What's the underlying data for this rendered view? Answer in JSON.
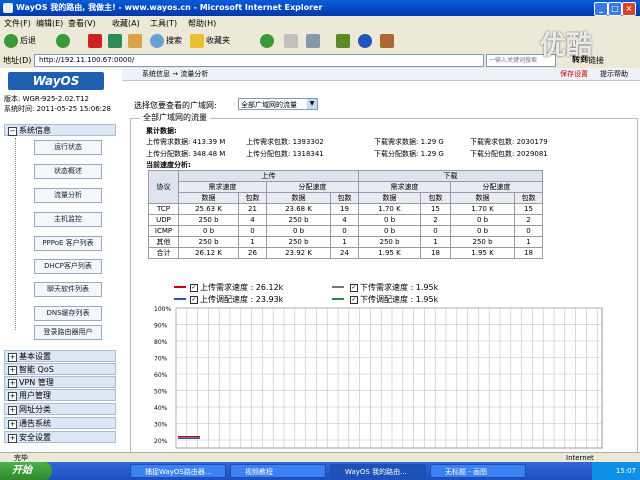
{
  "window": {
    "title": "WayOS 我的路由, 我做主! - www.wayos.cn - Microsoft Internet Explorer"
  },
  "menu": [
    "文件(F)",
    "编辑(E)",
    "查看(V)",
    "收藏(A)",
    "工具(T)",
    "帮助(H)"
  ],
  "toolbar": {
    "back": "后退",
    "search": "搜索",
    "favorites": "收藏夹"
  },
  "address": {
    "label": "地址(D)",
    "value": "http://192.11.100.67:0000/",
    "search_placeholder": "一输入关键词搜索",
    "go": "转到",
    "links": "链接"
  },
  "watermark": "优酷",
  "sidebar": {
    "logo": "WayOS",
    "version": "版本: WGR-925-2.02.T12",
    "sys_time": "系统时间: 2011-05-25 15:06:28",
    "top_section": "系统信息",
    "sub_items": [
      "运行状态",
      "状态概述",
      "流量分析",
      "主机监控",
      "PPPoE 客户列表",
      "DHCP客户列表",
      "聊天软件列表",
      "DNS缓存列表",
      "登录路由器用户"
    ],
    "sections": [
      "基本设置",
      "智能 QoS",
      "VPN 管理",
      "用户管理",
      "网址分类",
      "通告系统",
      "安全设置"
    ]
  },
  "main": {
    "breadcrumb": "系统信息 → 流量分析",
    "save_settings": "保存设置",
    "help": "提示帮助",
    "select_label": "选择您要查看的广域网:",
    "select_value": "全部广域网的流量",
    "panel_title": "全部广域网的流量",
    "cumulative_label": "累计数据:",
    "cum_line1": [
      "上传需求数据: 413.39 M",
      "上传需求包数: 1393302",
      "下载需求数据: 1.29 G",
      "下载需求包数: 2030179"
    ],
    "cum_line2": [
      "上传分配数据: 348.48 M",
      "上传分配包数: 1318341",
      "下载分配数据: 1.29 G",
      "下载分配包数: 2029081"
    ],
    "current_label": "当前速度分析:"
  },
  "table": {
    "col_protocol": "协议",
    "upload": "上传",
    "download": "下载",
    "demand": "需求速度",
    "alloc": "分配速度",
    "data": "数据",
    "packets": "包数",
    "rows": [
      {
        "proto": "TCP",
        "cells": [
          "25.63 K",
          "21",
          "23.68 K",
          "19",
          "1.70 K",
          "15",
          "1.70 K",
          "15"
        ]
      },
      {
        "proto": "UDP",
        "cells": [
          "250 b",
          "4",
          "250 b",
          "4",
          "0 b",
          "2",
          "0 b",
          "2"
        ]
      },
      {
        "proto": "ICMP",
        "cells": [
          "0 b",
          "0",
          "0 b",
          "0",
          "0 b",
          "0",
          "0 b",
          "0"
        ]
      },
      {
        "proto": "其他",
        "cells": [
          "250 b",
          "1",
          "250 b",
          "1",
          "250 b",
          "1",
          "250 b",
          "1"
        ]
      },
      {
        "proto": "合计",
        "cells": [
          "26.12 K",
          "26",
          "23.92 K",
          "24",
          "1.95 K",
          "18",
          "1.95 K",
          "18"
        ]
      }
    ]
  },
  "legend": {
    "up_demand": "上传需求速度 : 26.12k",
    "up_alloc": "上传调配速度 : 23.93k",
    "down_demand": "下传需求速度 : 1.95k",
    "down_alloc": "下传调配速度 : 1.95k"
  },
  "colors": {
    "up_demand": "#cc0000",
    "up_alloc": "#3355aa",
    "down_demand": "#777777",
    "down_alloc": "#228844"
  },
  "chart_data": {
    "type": "line",
    "y_ticks": [
      "100%",
      "90%",
      "80%",
      "70%",
      "60%",
      "50%",
      "40%",
      "30%",
      "20%"
    ],
    "ylim": [
      20,
      100
    ],
    "grid": true,
    "series": [
      {
        "name": "上传需求速度",
        "values": [
          22,
          22
        ]
      },
      {
        "name": "上传调配速度",
        "values": [
          21,
          21
        ]
      }
    ]
  },
  "status": {
    "left": "完毕",
    "right": "Internet"
  },
  "taskbar": {
    "start": "开始",
    "tasks": [
      "捕捉WayOS路由器...",
      "视频教程",
      "WayOS 我的路由...",
      "无标题 - 画图"
    ],
    "clock": "15:07"
  }
}
